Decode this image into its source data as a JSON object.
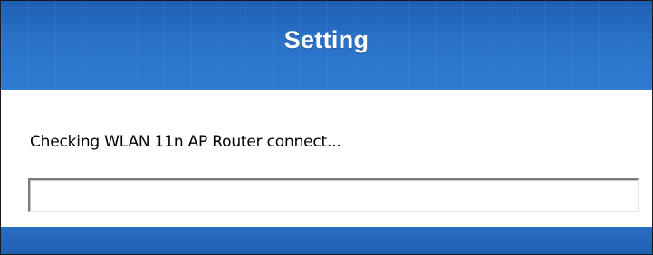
{
  "dialog": {
    "title": "Setting",
    "status_text": "Checking WLAN 11n AP Router connect...",
    "progress_fraction": 0.0,
    "colors": {
      "header": "#1f64b8",
      "footer": "#1f64b8",
      "title_text": "#ffffff"
    }
  }
}
